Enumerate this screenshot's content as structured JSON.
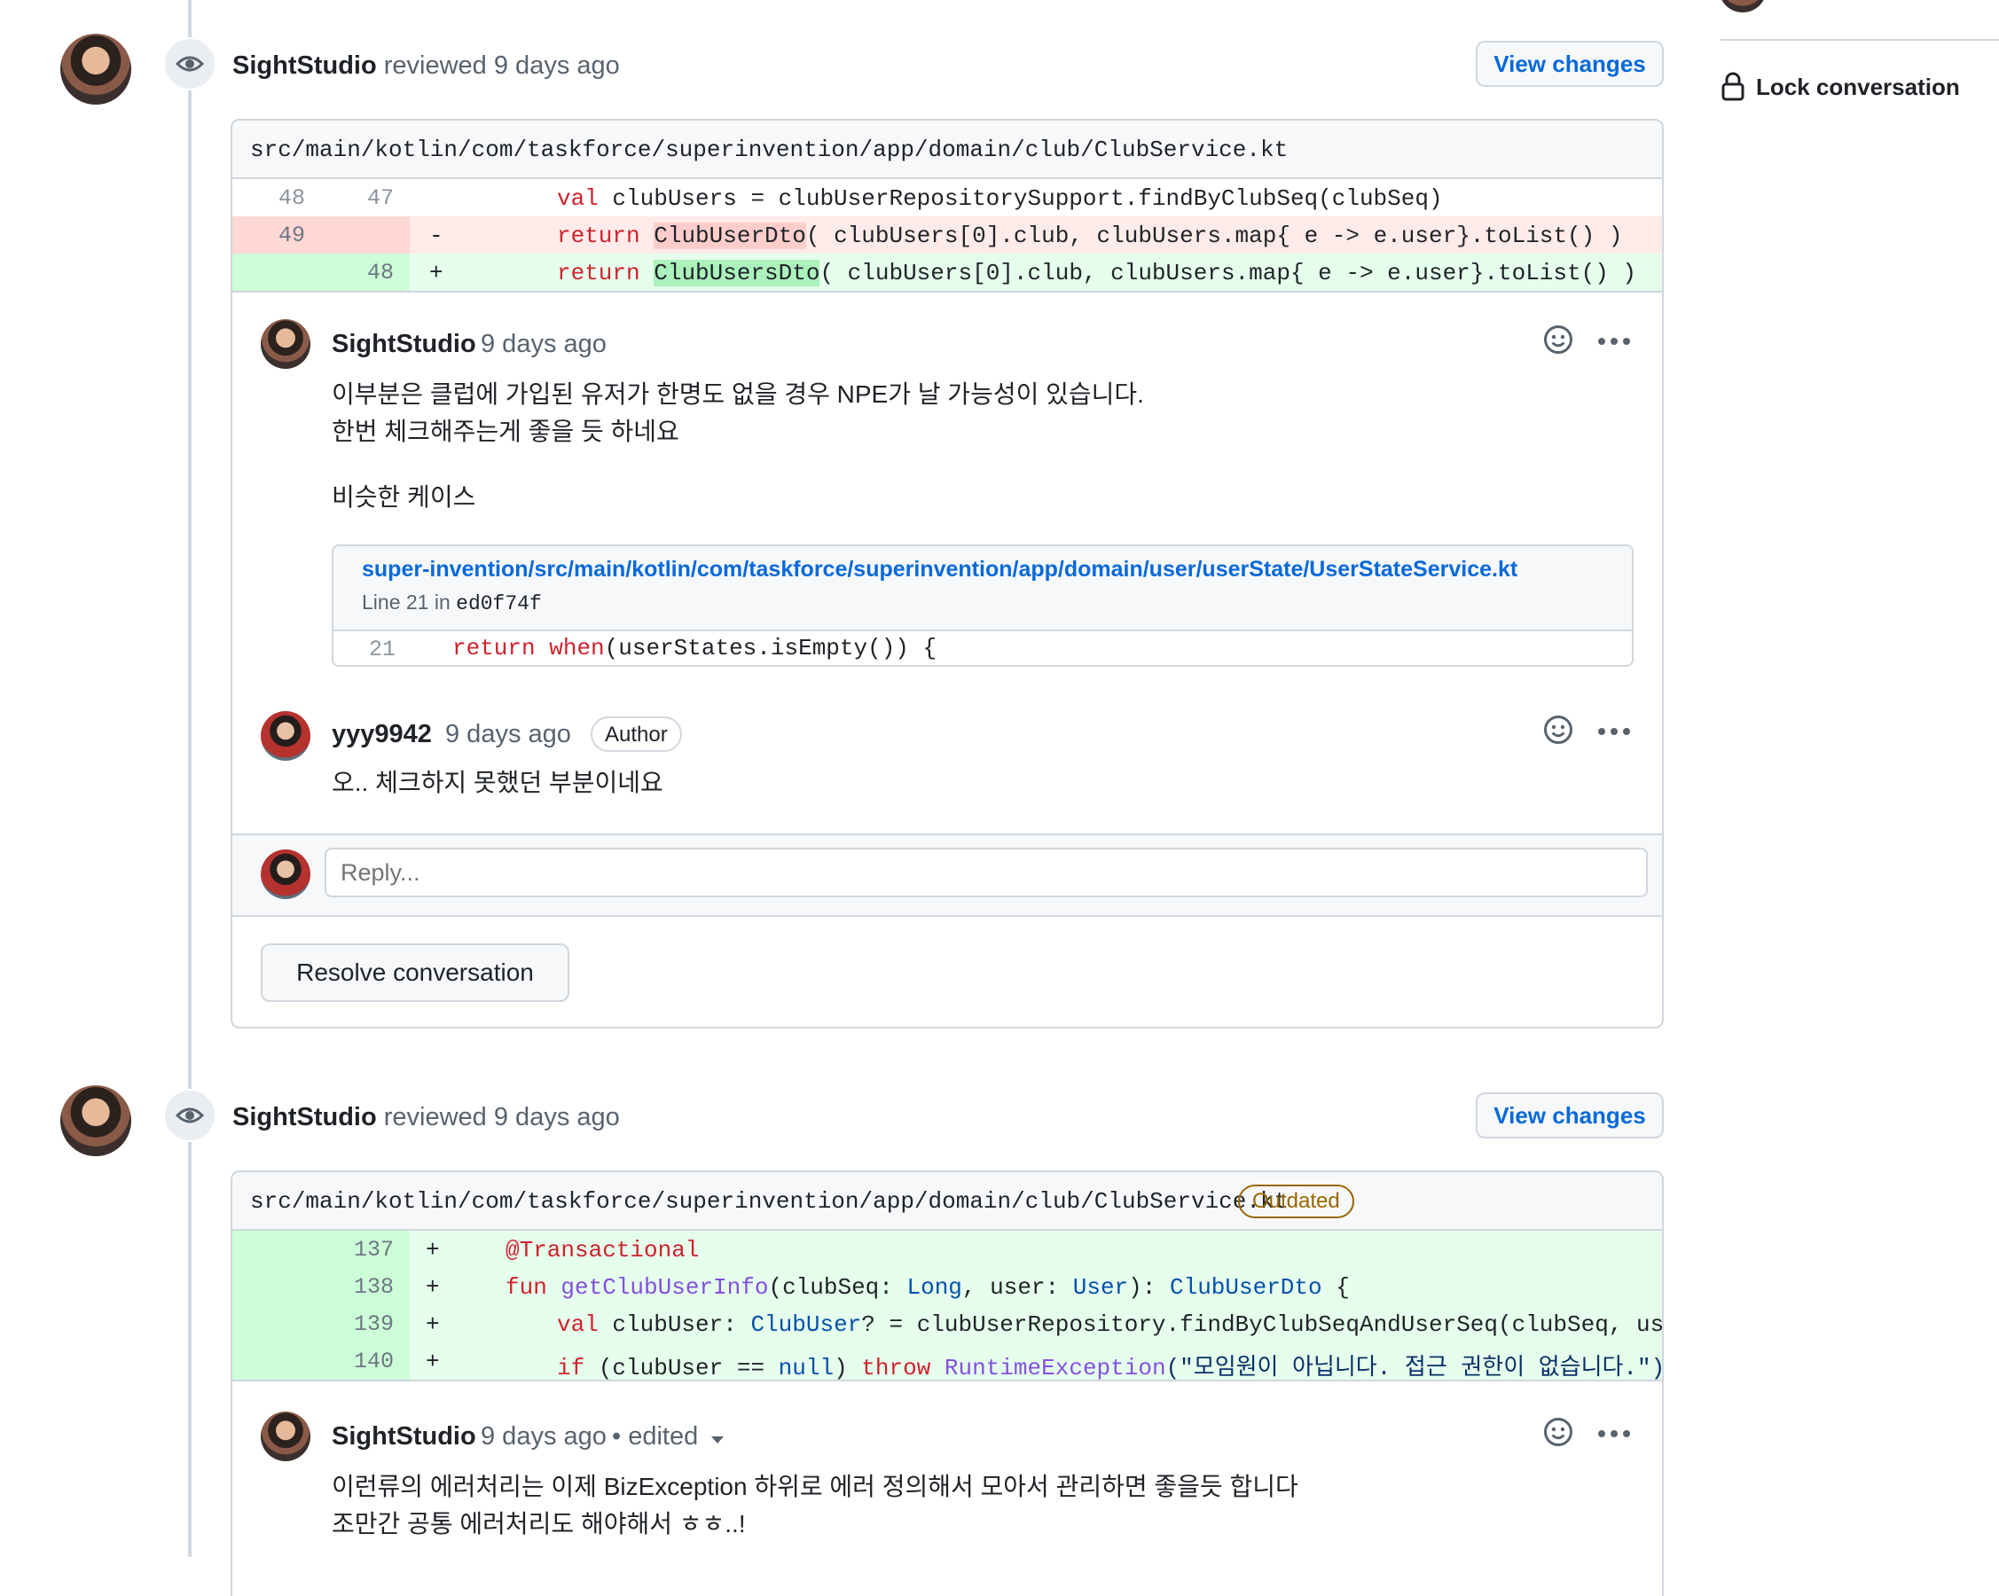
{
  "sidebar": {
    "lock_label": "Lock conversation"
  },
  "review1": {
    "user": "SightStudio",
    "action": "reviewed",
    "time": "9 days ago",
    "view_changes": "View changes",
    "file_path": "src/main/kotlin/com/taskforce/superinvention/app/domain/club/ClubService.kt",
    "diff": [
      {
        "old": "48",
        "new": "47",
        "sign": "",
        "type": "context"
      },
      {
        "old": "49",
        "new": "",
        "sign": "-",
        "type": "deletion"
      },
      {
        "old": "",
        "new": "48",
        "sign": "+",
        "type": "addition"
      }
    ],
    "code": {
      "line1_kw": "val",
      "line1_rest": " clubUsers = clubUserRepositorySupport.findByClubSeq(clubSeq)",
      "line2_kw": "return",
      "line2_hl": "ClubUserDto",
      "line2_rest": "( clubUsers[0].club, clubUsers.map{ e -> e.user}.toList() )",
      "line3_kw": "return",
      "line3_hl": "ClubUsersDto",
      "line3_rest": "( clubUsers[0].club, clubUsers.map{ e -> e.user}.toList() )"
    },
    "comments": [
      {
        "user": "SightStudio",
        "time": "9 days ago",
        "lines": [
          "이부분은 클럽에 가입된 유저가 한명도 없을 경우 NPE가 날 가능성이 있습니다.",
          "한번 체크해주는게 좋을 듯 하네요",
          "비슷한 케이스"
        ],
        "permalink": {
          "path": "super-invention/src/main/kotlin/com/taskforce/superinvention/app/domain/user/userState/UserStateService.kt",
          "line_info": "Line 21 in",
          "commit": "ed0f74f",
          "line_number": "21",
          "code_kw1": "return",
          "code_kw2": "when",
          "code_rest": "(userStates.isEmpty()) {"
        }
      },
      {
        "user": "yyy9942",
        "time": "9 days ago",
        "badge": "Author",
        "lines": [
          "오.. 체크하지 못했던 부분이네요"
        ]
      }
    ],
    "reply_placeholder": "Reply...",
    "resolve_label": "Resolve conversation"
  },
  "review2": {
    "user": "SightStudio",
    "action": "reviewed",
    "time": "9 days ago",
    "view_changes": "View changes",
    "file_path": "src/main/kotlin/com/taskforce/superinvention/app/domain/club/ClubService.kt",
    "outdated_label": "Outdated",
    "diff_lines": [
      "137",
      "138",
      "139",
      "140"
    ],
    "code": {
      "l137": "@Transactional",
      "l138_kw": "fun",
      "l138_fn": "getClubUserInfo",
      "l138_a": "(clubSeq: ",
      "l138_t1": "Long",
      "l138_b": ", user: ",
      "l138_t2": "User",
      "l138_c": "): ",
      "l138_t3": "ClubUserDto",
      "l138_d": " {",
      "l139_kw": "val",
      "l139_a": " clubUser: ",
      "l139_t": "ClubUser",
      "l139_b": "? = clubUserRepository.findByClubSeqAndUserSeq(clubSeq, user.seq",
      "l140_kw1": "if",
      "l140_a": " (clubUser == ",
      "l140_null": "null",
      "l140_b": ") ",
      "l140_kw2": "throw",
      "l140_c": " ",
      "l140_ex": "RuntimeException",
      "l140_str": "(\"모임원이 아닙니다. 접근 권한이 없습니다.\")"
    },
    "comment": {
      "user": "SightStudio",
      "time": "9 days ago",
      "edited": "• edited",
      "lines": [
        "이런류의 에러처리는 이제 BizException 하위로 에러 정의해서 모아서 관리하면 좋을듯 합니다",
        "조만간 공통 에러처리도 해야해서 ㅎㅎ..!"
      ]
    }
  },
  "colors": {
    "link": "#0969da",
    "deletion_bg": "#ffebe9",
    "deletion_num_bg": "#ffd7d5",
    "addition_bg": "#e6ffec",
    "addition_num_bg": "#ccffd8",
    "outdated": "#9a6700"
  },
  "icons": [
    "eye-icon",
    "lock-icon",
    "smiley-icon",
    "kebab-icon",
    "caret-down-icon"
  ]
}
